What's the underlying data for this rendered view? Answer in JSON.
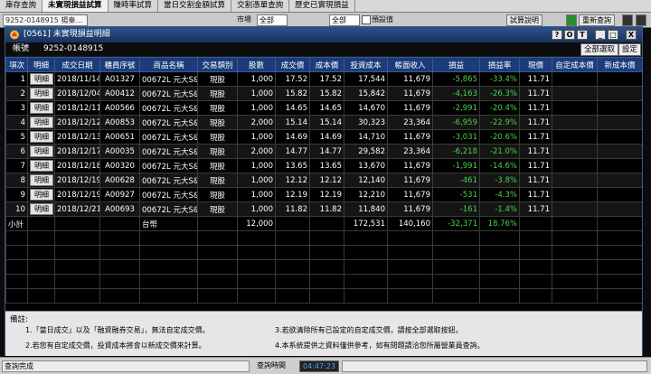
{
  "app_tabs": [
    "庫存查詢",
    "未實現損益試算",
    "賺時率試算",
    "當日交割金額試算",
    "交割憑單查詢",
    "歷史已實現損益"
  ],
  "active_tab": 1,
  "behind": {
    "account": "9252-0148915 楊秦...",
    "select1": "全部",
    "select2": "全部",
    "label1": "市場",
    "label2": "預設值",
    "btn_calc": "試算說明",
    "btn_refresh": "重新查詢"
  },
  "window": {
    "title": "[0561] 未實現損益明細",
    "buttons": [
      "?",
      "O",
      "T",
      "_",
      "□",
      "X"
    ]
  },
  "account": {
    "label": "帳號",
    "value": "9252-0148915",
    "btn_select_all": "全部選取",
    "btn_settings": "設定"
  },
  "table": {
    "headers": [
      "項次",
      "明細",
      "成交日期",
      "櫃員序號",
      "商品名稱",
      "交易類別",
      "股數",
      "成交價",
      "成本價",
      "投資成本",
      "帳面收入",
      "損益",
      "損益率",
      "現價",
      "自定成本價",
      "新成本價"
    ],
    "detail_label": "明細",
    "rows": [
      [
        "1",
        "2018/11/14",
        "A01327",
        "00672L 元大S&",
        "現股",
        "1,000",
        "17.52",
        "17.52",
        "17,544",
        "11,679",
        "-5,865",
        "-33.4%",
        "11.71"
      ],
      [
        "2",
        "2018/12/04",
        "A00412",
        "00672L 元大S&",
        "現股",
        "1,000",
        "15.82",
        "15.82",
        "15,842",
        "11,679",
        "-4,163",
        "-26.3%",
        "11.71"
      ],
      [
        "3",
        "2018/12/11",
        "A00566",
        "00672L 元大S&",
        "現股",
        "1,000",
        "14.65",
        "14.65",
        "14,670",
        "11,679",
        "-2,991",
        "-20.4%",
        "11.71"
      ],
      [
        "4",
        "2018/12/12",
        "A00853",
        "00672L 元大S&",
        "現股",
        "2,000",
        "15.14",
        "15.14",
        "30,323",
        "23,364",
        "-6,959",
        "-22.9%",
        "11.71"
      ],
      [
        "5",
        "2018/12/13",
        "A00651",
        "00672L 元大S&",
        "現股",
        "1,000",
        "14.69",
        "14.69",
        "14,710",
        "11,679",
        "-3,031",
        "-20.6%",
        "11.71"
      ],
      [
        "6",
        "2018/12/17",
        "A00035",
        "00672L 元大S&",
        "現股",
        "2,000",
        "14.77",
        "14.77",
        "29,582",
        "23,364",
        "-6,218",
        "-21.0%",
        "11.71"
      ],
      [
        "7",
        "2018/12/18",
        "A00320",
        "00672L 元大S&",
        "現股",
        "1,000",
        "13.65",
        "13.65",
        "13,670",
        "11,679",
        "-1,991",
        "-14.6%",
        "11.71"
      ],
      [
        "8",
        "2018/12/19",
        "A00628",
        "00672L 元大S&",
        "現股",
        "1,000",
        "12.12",
        "12.12",
        "12,140",
        "11,679",
        "-461",
        "-3.8%",
        "11.71"
      ],
      [
        "9",
        "2018/12/19",
        "A00927",
        "00672L 元大S&",
        "現股",
        "1,000",
        "12.19",
        "12.19",
        "12,210",
        "11,679",
        "-531",
        "-4.3%",
        "11.71"
      ],
      [
        "10",
        "2018/12/21",
        "A00693",
        "00672L 元大S&",
        "現股",
        "1,000",
        "11.82",
        "11.82",
        "11,840",
        "11,679",
        "-161",
        "-1.4%",
        "11.71"
      ]
    ],
    "subtotal": {
      "label": "小計",
      "currency": "台幣",
      "shares": "12,000",
      "cost": "172,531",
      "income": "140,160",
      "pnl": "-32,371",
      "pnl_rate": "18.76%"
    }
  },
  "notes": {
    "title": "備註:",
    "items": [
      "1.「當日成交」以及「融資融券交易」，無法自定成交價。",
      "2.若您有自定成交價，投資成本將會以新成交價來計算。",
      "3.若欲清除所有已設定的自定成交價，請按全部選取按鈕。",
      "4.本系統提供之資料僅供參考，如有問題請洽您所屬營業員查詢。"
    ]
  },
  "status": {
    "message": "查詢完成",
    "time_label": "查詢時間",
    "time": "04:47:23"
  },
  "colors": {
    "header": "#1b3c7a",
    "titlebar": "#2d5288",
    "loss": "#4bd04b",
    "gain": "#ff4a4a",
    "time": "#4aa3ff"
  }
}
